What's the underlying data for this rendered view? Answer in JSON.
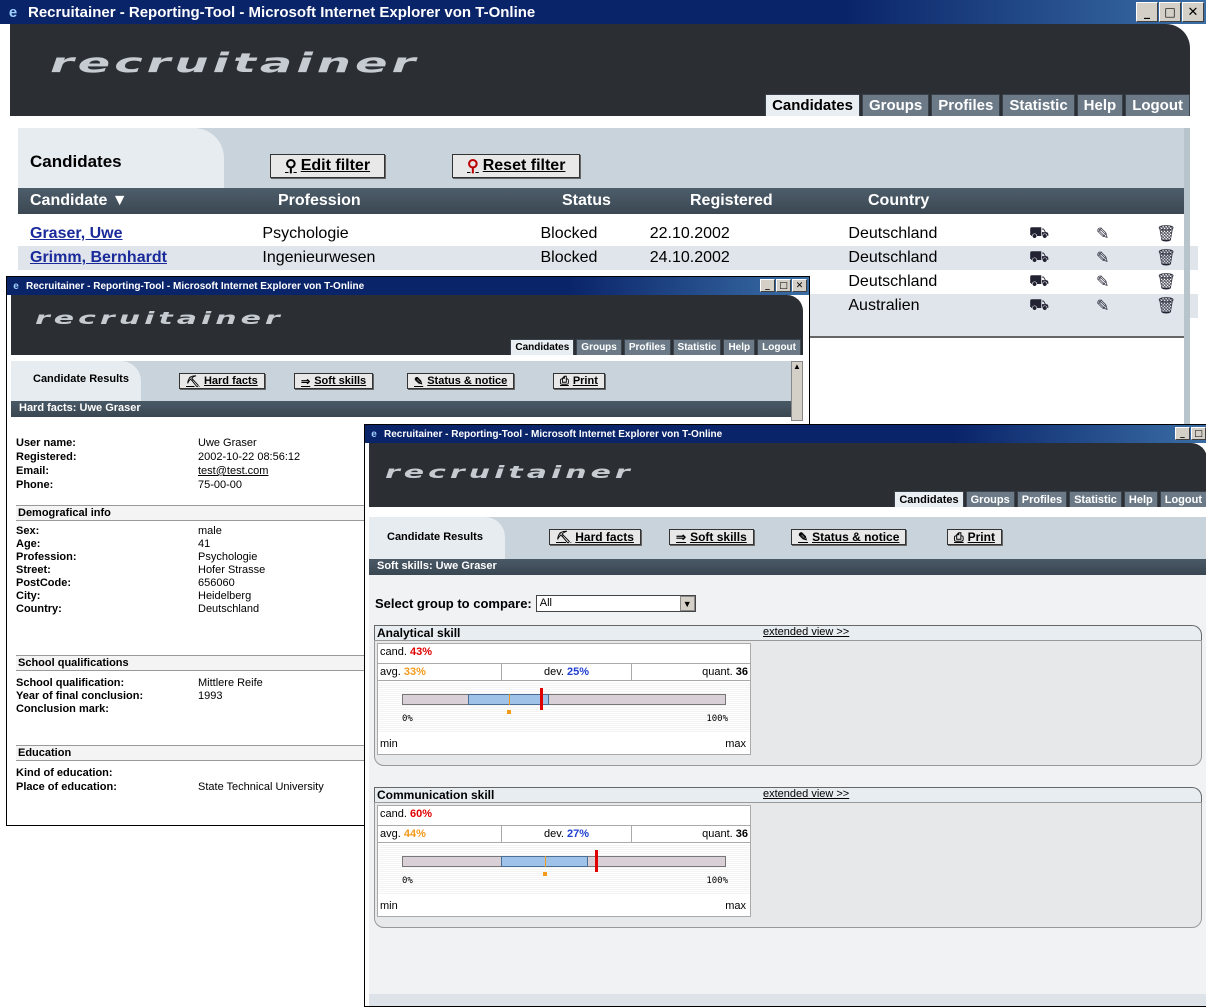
{
  "app": {
    "window_title": "Recruitainer - Reporting-Tool - Microsoft Internet Explorer von T-Online",
    "logo": "recruitainer",
    "nav": [
      "Candidates",
      "Groups",
      "Profiles",
      "Statistic",
      "Help",
      "Logout"
    ]
  },
  "main": {
    "section_label": "Candidates",
    "edit_filter": "Edit filter",
    "reset_filter": "Reset filter",
    "columns": [
      "Candidate",
      "Profession",
      "Status",
      "Registered",
      "Country"
    ],
    "rows": [
      {
        "name": "Graser, Uwe",
        "profession": "Psychologie",
        "status": "Blocked",
        "registered": "22.10.2002",
        "country": "Deutschland"
      },
      {
        "name": "Grimm, Bernhardt",
        "profession": "Ingenieurwesen",
        "status": "Blocked",
        "registered": "24.10.2002",
        "country": "Deutschland"
      },
      {
        "country": "Deutschland"
      },
      {
        "country": "Australien"
      }
    ]
  },
  "candidate_window": {
    "section_label": "Candidate Results",
    "buttons": [
      "Hard facts",
      "Soft skills",
      "Status & notice",
      "Print"
    ],
    "title_bar": "Hard facts: Uwe Graser",
    "general": [
      {
        "k": "User name:",
        "v": "Uwe Graser"
      },
      {
        "k": "Registered:",
        "v": "2002-10-22 08:56:12"
      },
      {
        "k": "Email:",
        "v": "test@test.com"
      },
      {
        "k": "Phone:",
        "v": "75-00-00"
      }
    ],
    "demo_title": "Demografical info",
    "demo": [
      {
        "k": "Sex:",
        "v": "male"
      },
      {
        "k": "Age:",
        "v": "41"
      },
      {
        "k": "Profession:",
        "v": "Psychologie"
      },
      {
        "k": "Street:",
        "v": "Hofer Strasse"
      },
      {
        "k": "PostCode:",
        "v": "656060"
      },
      {
        "k": "City:",
        "v": "Heidelberg"
      },
      {
        "k": "Country:",
        "v": "Deutschland"
      }
    ],
    "school_title": "School qualifications",
    "school": [
      {
        "k": "School qualification:",
        "v": "Mittlere Reife"
      },
      {
        "k": "Year of final conclusion:",
        "v": "1993"
      },
      {
        "k": "Conclusion mark:",
        "v": ""
      }
    ],
    "edu_title": "Education",
    "edu": [
      {
        "k": "Kind of education:",
        "v": ""
      },
      {
        "k": "Place of education:",
        "v": "State Technical University"
      }
    ]
  },
  "soft_window": {
    "section_label": "Candidate Results",
    "buttons": [
      "Hard facts",
      "Soft skills",
      "Status & notice",
      "Print"
    ],
    "title_bar": "Soft skills: Uwe Graser",
    "compare_label": "Select group to compare:",
    "compare_value": "All",
    "extended": "extended view >>",
    "skills": [
      {
        "name": "Analytical skill",
        "cand_label": "cand.",
        "cand": "43%",
        "avg_label": "avg.",
        "avg": "33%",
        "dev_label": "dev.",
        "dev": "25%",
        "quant_label": "quant.",
        "quant": "36",
        "cand_v": 43,
        "avg_v": 33,
        "dev_v": 25
      },
      {
        "name": "Communication skill",
        "cand_label": "cand.",
        "cand": "60%",
        "avg_label": "avg.",
        "avg": "44%",
        "dev_label": "dev.",
        "dev": "27%",
        "quant_label": "quant.",
        "quant": "36",
        "cand_v": 60,
        "avg_v": 44,
        "dev_v": 27
      }
    ],
    "scale_min": "0%",
    "scale_max": "100%",
    "min_label": "min",
    "max_label": "max"
  }
}
